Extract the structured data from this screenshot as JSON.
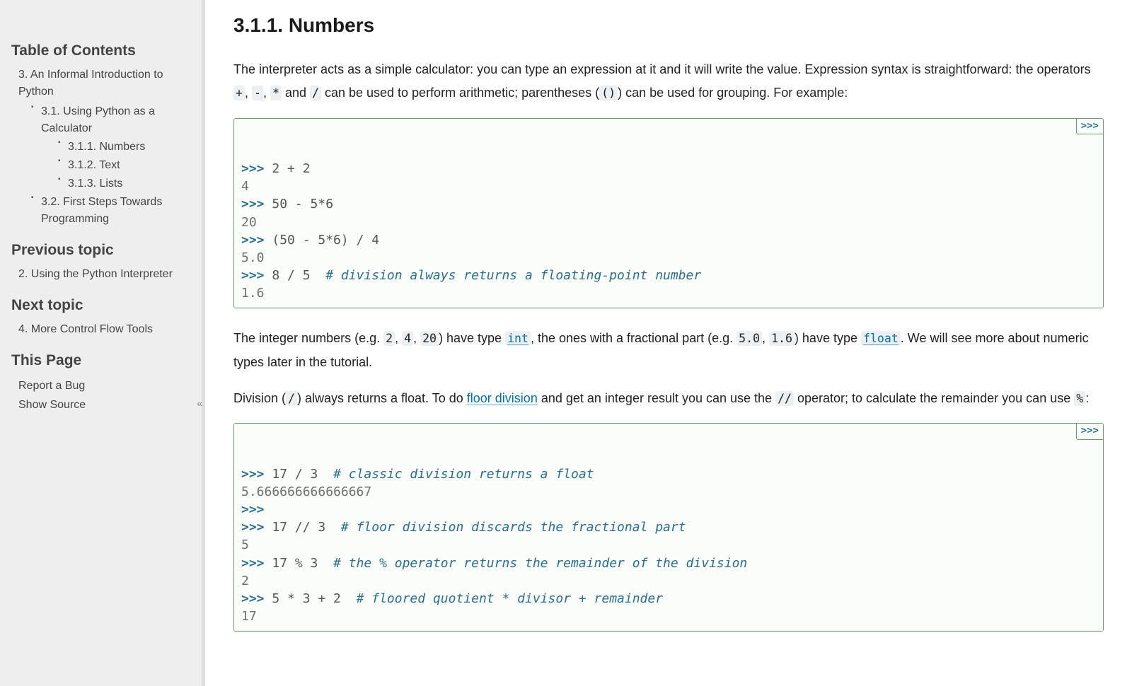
{
  "sidebar": {
    "toc_heading": "Table of Contents",
    "toc": {
      "root": "3. An Informal Introduction to Python",
      "l2": [
        {
          "label": "3.1. Using Python as a Calculator",
          "children": [
            "3.1.1. Numbers",
            "3.1.2. Text",
            "3.1.3. Lists"
          ]
        },
        {
          "label": "3.2. First Steps Towards Programming",
          "children": []
        }
      ]
    },
    "prev_heading": "Previous topic",
    "prev_link": "2. Using the Python Interpreter",
    "next_heading": "Next topic",
    "next_link": "4. More Control Flow Tools",
    "this_page_heading": "This Page",
    "report_bug": "Report a Bug",
    "show_source": "Show Source",
    "collapse_glyph": "«"
  },
  "main": {
    "heading": "3.1.1. Numbers",
    "para1": {
      "t1": "The interpreter acts as a simple calculator: you can type an expression at it and it will write the value. Expression syntax is straightforward: the operators ",
      "op_plus": "+",
      "t2": ", ",
      "op_minus": "-",
      "t3": ", ",
      "op_star": "*",
      "t4": " and ",
      "op_slash": "/",
      "t5": " can be used to perform arithmetic; parentheses (",
      "paren": "()",
      "t6": ") can be used for grouping. For example:"
    },
    "code1": {
      "toggle": ">>>",
      "lines": [
        {
          "kind": "in",
          "prompt": ">>> ",
          "text": "2 + 2"
        },
        {
          "kind": "out",
          "text": "4"
        },
        {
          "kind": "in",
          "prompt": ">>> ",
          "text": "50 - 5*6"
        },
        {
          "kind": "out",
          "text": "20"
        },
        {
          "kind": "in",
          "prompt": ">>> ",
          "text": "(50 - 5*6) / 4"
        },
        {
          "kind": "out",
          "text": "5.0"
        },
        {
          "kind": "inC",
          "prompt": ">>> ",
          "text": "8 / 5  ",
          "comment": "# division always returns a floating-point number"
        },
        {
          "kind": "out",
          "text": "1.6"
        }
      ]
    },
    "para2": {
      "t1": "The integer numbers (e.g. ",
      "n1": "2",
      "t2": ", ",
      "n2": "4",
      "t3": ", ",
      "n3": "20",
      "t4": ") have type ",
      "link_int": "int",
      "t5": ", the ones with a fractional part (e.g. ",
      "n4": "5.0",
      "t6": ", ",
      "n5": "1.6",
      "t7": ") have type ",
      "link_float": "float",
      "t8": ". We will see more about numeric types later in the tutorial."
    },
    "para3": {
      "t1": "Division (",
      "slash": "/",
      "t2": ") always returns a float. To do ",
      "link_floor": "floor division",
      "t3": " and get an integer result you can use the ",
      "dslash": "//",
      "t4": " operator; to calculate the remainder you can use ",
      "pct": "%",
      "t5": ":"
    },
    "code2": {
      "toggle": ">>>",
      "lines": [
        {
          "kind": "inC",
          "prompt": ">>> ",
          "text": "17 / 3  ",
          "comment": "# classic division returns a float"
        },
        {
          "kind": "out",
          "text": "5.666666666666667"
        },
        {
          "kind": "in",
          "prompt": ">>> ",
          "text": ""
        },
        {
          "kind": "inC",
          "prompt": ">>> ",
          "text": "17 // 3  ",
          "comment": "# floor division discards the fractional part"
        },
        {
          "kind": "out",
          "text": "5"
        },
        {
          "kind": "inC",
          "prompt": ">>> ",
          "text": "17 % 3  ",
          "comment": "# the % operator returns the remainder of the division"
        },
        {
          "kind": "out",
          "text": "2"
        },
        {
          "kind": "inC",
          "prompt": ">>> ",
          "text": "5 * 3 + 2  ",
          "comment": "# floored quotient * divisor + remainder"
        },
        {
          "kind": "out",
          "text": "17"
        }
      ]
    }
  }
}
